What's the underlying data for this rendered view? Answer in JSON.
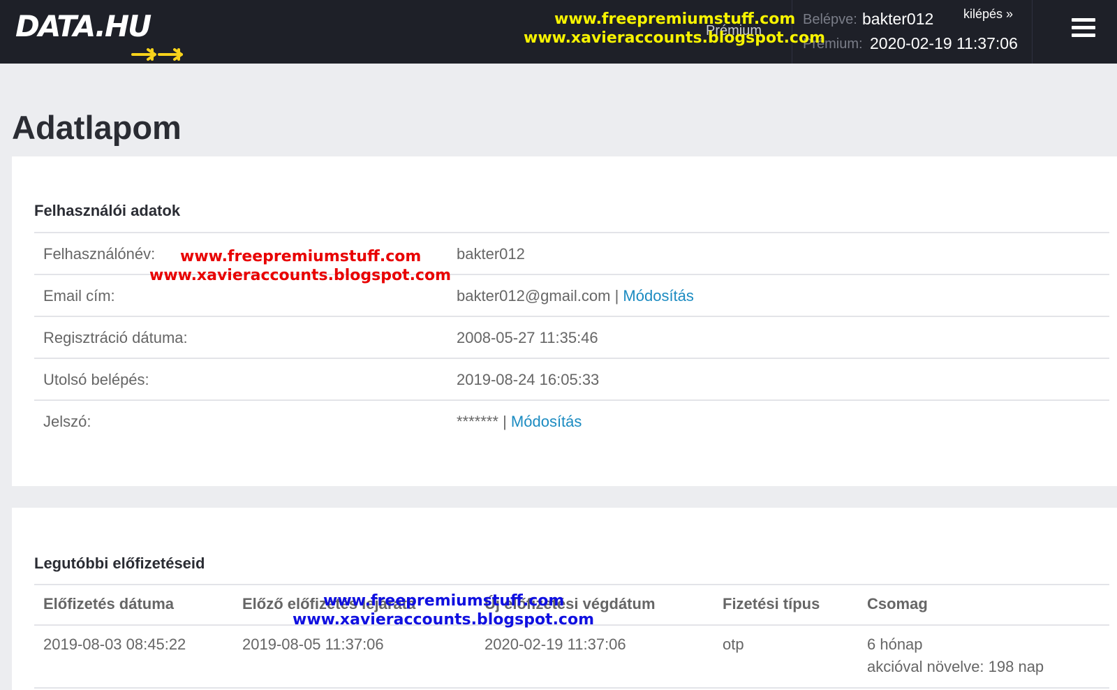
{
  "header": {
    "logo": "DATA.HU",
    "watermark_line1": "www.freepremiumstuff.com",
    "watermark_line2": "www.xavieraccounts.blogspot.com",
    "logged_in_label": "Belépve:",
    "username": "bakter012",
    "logout_label": "kilépés »",
    "premium_tag": "Prémium",
    "premium_label": "Prémium:",
    "premium_until": "2020-02-19 11:37:06"
  },
  "page": {
    "title": "Adatlapom"
  },
  "user_data": {
    "section_title": "Felhasználói adatok",
    "rows": [
      {
        "label": "Felhasználónév:",
        "value": "bakter012"
      },
      {
        "label": "Email cím:",
        "value": "bakter012@gmail.com",
        "link": "Módosítás"
      },
      {
        "label": "Regisztráció dátuma:",
        "value": "2008-05-27 11:35:46"
      },
      {
        "label": "Utolsó belépés:",
        "value": "2019-08-24 16:05:33"
      },
      {
        "label": "Jelszó:",
        "value": "*******",
        "link": "Módosítás"
      }
    ],
    "separator": "|",
    "watermark_line1": "www.freepremiumstuff.com",
    "watermark_line2": "www.xavieraccounts.blogspot.com"
  },
  "subscriptions": {
    "section_title": "Legutóbbi előfizetéseid",
    "columns": [
      "Előfizetés dátuma",
      "Előző előfizetés lejárata",
      "Új előfizetési végdátum",
      "Fizetési típus",
      "Csomag"
    ],
    "rows": [
      {
        "date": "2019-08-03 08:45:22",
        "prev_expiry": "2019-08-05 11:37:06",
        "new_end": "2020-02-19 11:37:06",
        "payment_type": "otp",
        "package": "6 hónap",
        "package_extra": "akcióval növelve: 198 nap"
      }
    ],
    "watermark_line1": "www.freepremiumstuff.com",
    "watermark_line2": "www.xavieraccounts.blogspot.com"
  },
  "colors": {
    "topbar": "#1e2028",
    "link": "#1b8bc1",
    "logo_accent": "#f7d21b",
    "watermark_yellow": "#f7f300",
    "watermark_red": "#e80000",
    "watermark_blue": "#1010e0"
  }
}
